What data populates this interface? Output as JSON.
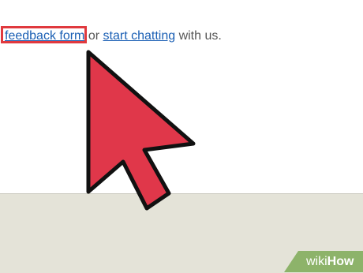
{
  "message": {
    "link_feedback": "feedback form",
    "connector": " or ",
    "link_chat": "start chatting",
    "tail": " with us."
  },
  "watermark": {
    "wiki": "wiki",
    "how": "How"
  },
  "colors": {
    "link": "#1a5fb4",
    "highlight": "#e0393e",
    "cursor_fill": "#e0374a",
    "footer_bg": "#e4e3d8",
    "badge_green": "#8db36a"
  },
  "icons": {
    "pointer": "cursor-arrow-icon"
  }
}
